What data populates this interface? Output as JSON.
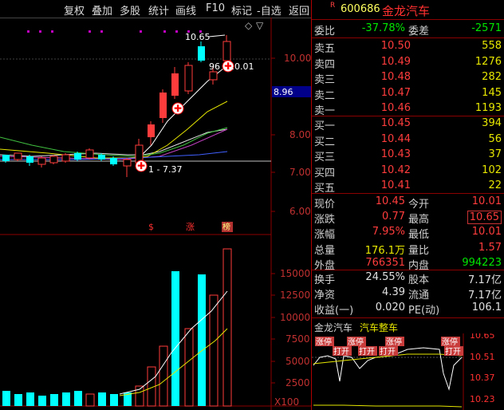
{
  "toolbar": {
    "buttons": [
      "复权",
      "叠加",
      "多股",
      "统计",
      "画线",
      "F10",
      "标记",
      "-自选",
      "返回"
    ]
  },
  "main_chart": {
    "price_ticks": [
      "10.00",
      "9.00",
      "8.00",
      "7.00",
      "6.00"
    ],
    "current_price_tag": "8.96",
    "annotation_high": "10.65",
    "annotation_mid": "96 - 10.01",
    "annotation_low": "1 - 7.37",
    "event_markers": [
      "$",
      "涨",
      "榜"
    ]
  },
  "volume_chart": {
    "ticks": [
      "15000",
      "12500",
      "10000",
      "7500",
      "5000",
      "2500"
    ],
    "unit": "X100"
  },
  "quote": {
    "code_prefix": "R",
    "code": "600686",
    "name": "金龙汽车",
    "weibi_label": "委比",
    "weibi_value": "-37.78%",
    "weicha_label": "委差",
    "weicha_value": "-2571",
    "asks": [
      {
        "label": "卖五",
        "price": "10.50",
        "vol": "558"
      },
      {
        "label": "卖四",
        "price": "10.49",
        "vol": "1276"
      },
      {
        "label": "卖三",
        "price": "10.48",
        "vol": "282"
      },
      {
        "label": "卖二",
        "price": "10.47",
        "vol": "145"
      },
      {
        "label": "卖一",
        "price": "10.46",
        "vol": "1193"
      }
    ],
    "bids": [
      {
        "label": "买一",
        "price": "10.45",
        "vol": "394"
      },
      {
        "label": "买二",
        "price": "10.44",
        "vol": "56"
      },
      {
        "label": "买三",
        "price": "10.43",
        "vol": "37"
      },
      {
        "label": "买四",
        "price": "10.42",
        "vol": "102"
      },
      {
        "label": "买五",
        "price": "10.41",
        "vol": "22"
      }
    ],
    "stats": [
      {
        "l1": "现价",
        "v1": "10.45",
        "l2": "今开",
        "v2": "10.01"
      },
      {
        "l1": "涨跌",
        "v1": "0.77",
        "l2": "最高",
        "v2": "10.65"
      },
      {
        "l1": "涨幅",
        "v1": "7.95%",
        "l2": "最低",
        "v2": "10.01"
      },
      {
        "l1": "总量",
        "v1": "176.1万",
        "l2": "量比",
        "v2": "1.57"
      },
      {
        "l1": "外盘",
        "v1": "766351",
        "l2": "内盘",
        "v2": "994223"
      }
    ],
    "stats2": [
      {
        "l1": "换手",
        "v1": "24.55%",
        "l2": "股本",
        "v2": "7.17亿"
      },
      {
        "l1": "净资",
        "v1": "4.39",
        "l2": "流通",
        "v2": "7.17亿"
      },
      {
        "l1": "收益(一)",
        "v1": "0.020",
        "l2": "PE(动)",
        "v2": "106.1"
      }
    ]
  },
  "mini_chart": {
    "name": "金龙汽车",
    "sector": "汽车整车",
    "ticks": [
      "10.65",
      "10.51",
      "10.37",
      "10.23"
    ],
    "tags": [
      "涨停",
      "涨停",
      "涨停",
      "涨停",
      "打开",
      "打开",
      "打开",
      "打开"
    ]
  },
  "colors": {
    "up": "#ff3c3c",
    "down": "#00ffff",
    "bg": "#000000"
  }
}
